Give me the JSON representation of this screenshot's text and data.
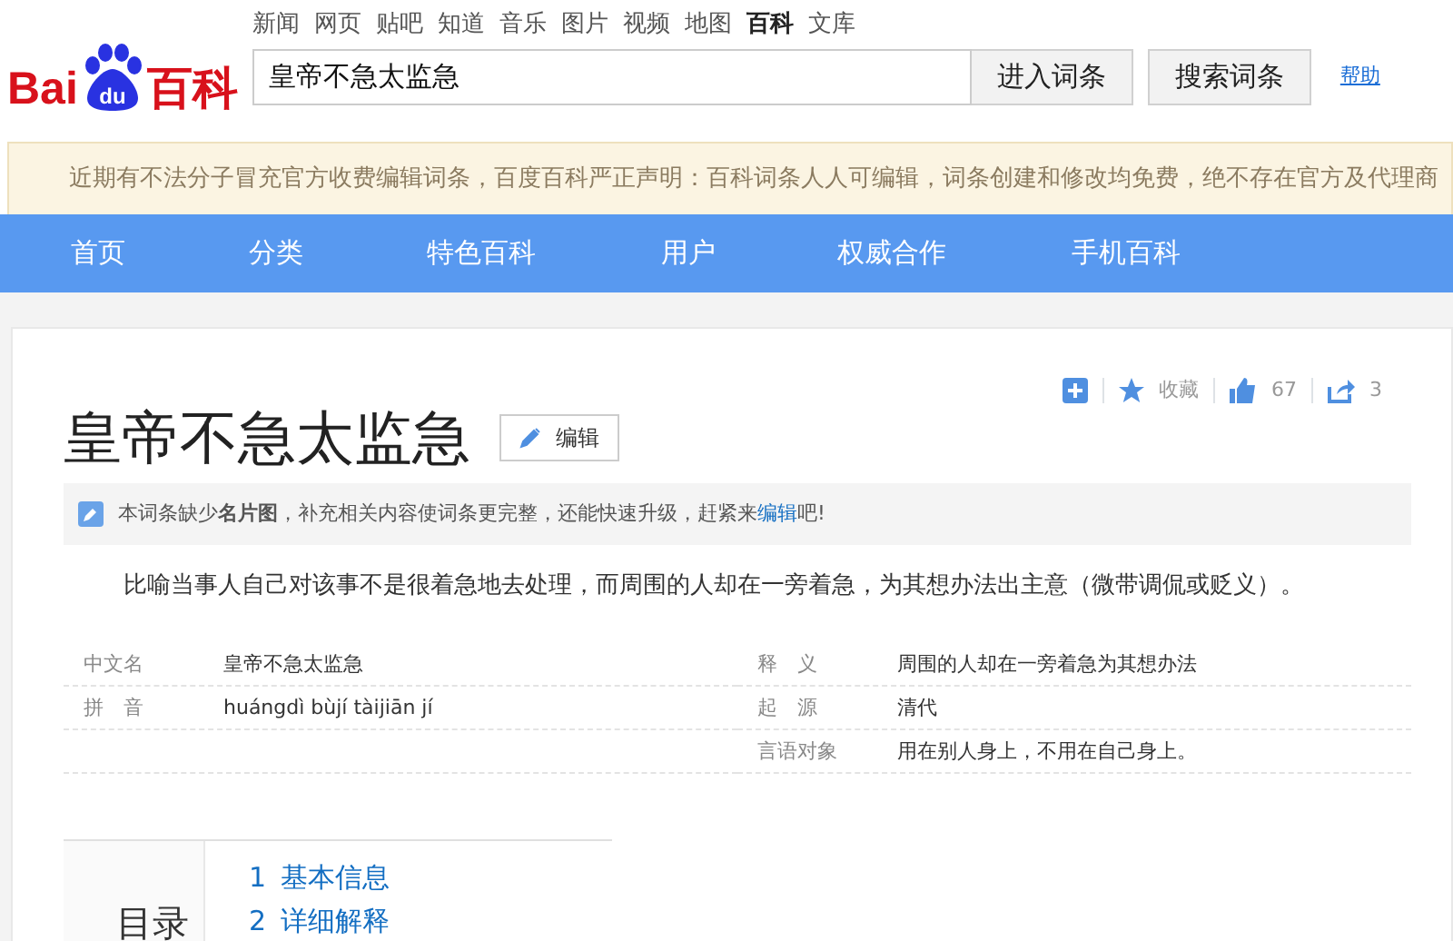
{
  "logo": {
    "left": "Bai",
    "paw": "du",
    "right": "百科"
  },
  "top_links": [
    {
      "label": "新闻",
      "selected": false
    },
    {
      "label": "网页",
      "selected": false
    },
    {
      "label": "贴吧",
      "selected": false
    },
    {
      "label": "知道",
      "selected": false
    },
    {
      "label": "音乐",
      "selected": false
    },
    {
      "label": "图片",
      "selected": false
    },
    {
      "label": "视频",
      "selected": false
    },
    {
      "label": "地图",
      "selected": false
    },
    {
      "label": "百科",
      "selected": true
    },
    {
      "label": "文库",
      "selected": false
    }
  ],
  "search": {
    "value": "皇帝不急太监急",
    "buttons": [
      "进入词条",
      "搜索词条"
    ],
    "help": "帮助"
  },
  "notice": "近期有不法分子冒充官方收费编辑词条，百度百科严正声明：百科词条人人可编辑，词条创建和修改均免费，绝不存在官方及代理商",
  "nav": [
    "首页",
    "分类",
    "特色百科",
    "用户",
    "权威合作",
    "手机百科"
  ],
  "actions": {
    "collect": "收藏",
    "likes": "67",
    "shares": "3"
  },
  "title": "皇帝不急太监急",
  "edit_button": "编辑",
  "tip": "本词条缺少**名片图**，补充相关内容使词条更完整，还能快速升级，赶紧来",
  "tip_link": "编辑",
  "tip_end": "吧!",
  "summary": "比喻当事人自己对该事不是很着急地去处理，而周围的人却在一旁着急，为其想办法出主意（微带调侃或贬义）。",
  "info_left": [
    {
      "name": "中文名",
      "value": "皇帝不急太监急"
    },
    {
      "name": "拼　音",
      "value": "huángdì bùjí tàijiān jí"
    }
  ],
  "info_right": [
    {
      "name": "释　义",
      "value": "周围的人却在一旁着急为其想办法"
    },
    {
      "name": "起　源",
      "value": "清代"
    },
    {
      "name": "言语对象",
      "value": "用在别人身上，不用在自己身上。"
    }
  ],
  "toc": {
    "title": "目录",
    "items": [
      {
        "number": "1",
        "label": "基本信息"
      },
      {
        "number": "2",
        "label": "详细解释"
      }
    ]
  }
}
